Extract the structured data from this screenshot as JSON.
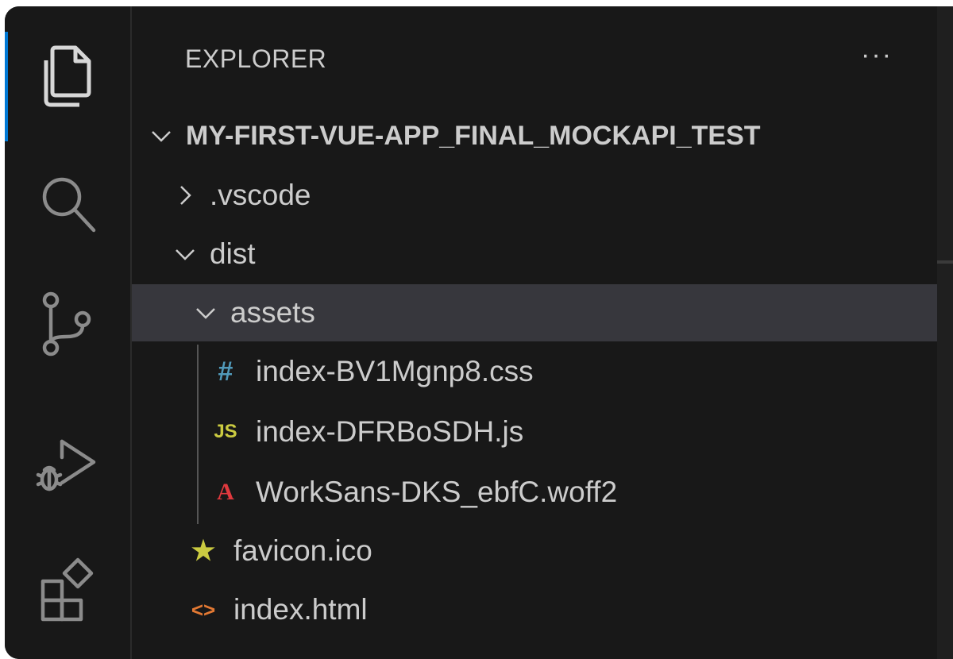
{
  "activity_bar": {
    "items": [
      {
        "name": "explorer-icon",
        "active": true
      },
      {
        "name": "search-icon"
      },
      {
        "name": "source-control-icon"
      },
      {
        "name": "run-debug-icon"
      },
      {
        "name": "extensions-icon"
      }
    ]
  },
  "explorer": {
    "title": "EXPLORER",
    "more_actions": "···",
    "root_folder": "MY-FIRST-VUE-APP_FINAL_MOCKAPI_TEST",
    "tree": {
      "vscode": ".vscode",
      "dist": "dist",
      "assets": "assets",
      "css_file": "index-BV1Mgnp8.css",
      "js_file": "index-DFRBoSDH.js",
      "font_file": "WorkSans-DKS_ebfC.woff2",
      "favicon": "favicon.ico",
      "index_html": "index.html"
    },
    "icons": {
      "css": "#",
      "js": "JS",
      "font": "A",
      "favicon": "★",
      "html": "<>"
    }
  },
  "colors": {
    "background": "#181818",
    "selected_row": "#37373d",
    "active_indicator": "#0078d4",
    "css_icon": "#519aba",
    "js_icon": "#cbcb41",
    "font_icon": "#e0393e",
    "favicon_icon": "#cbcb41",
    "html_icon": "#e37933"
  }
}
